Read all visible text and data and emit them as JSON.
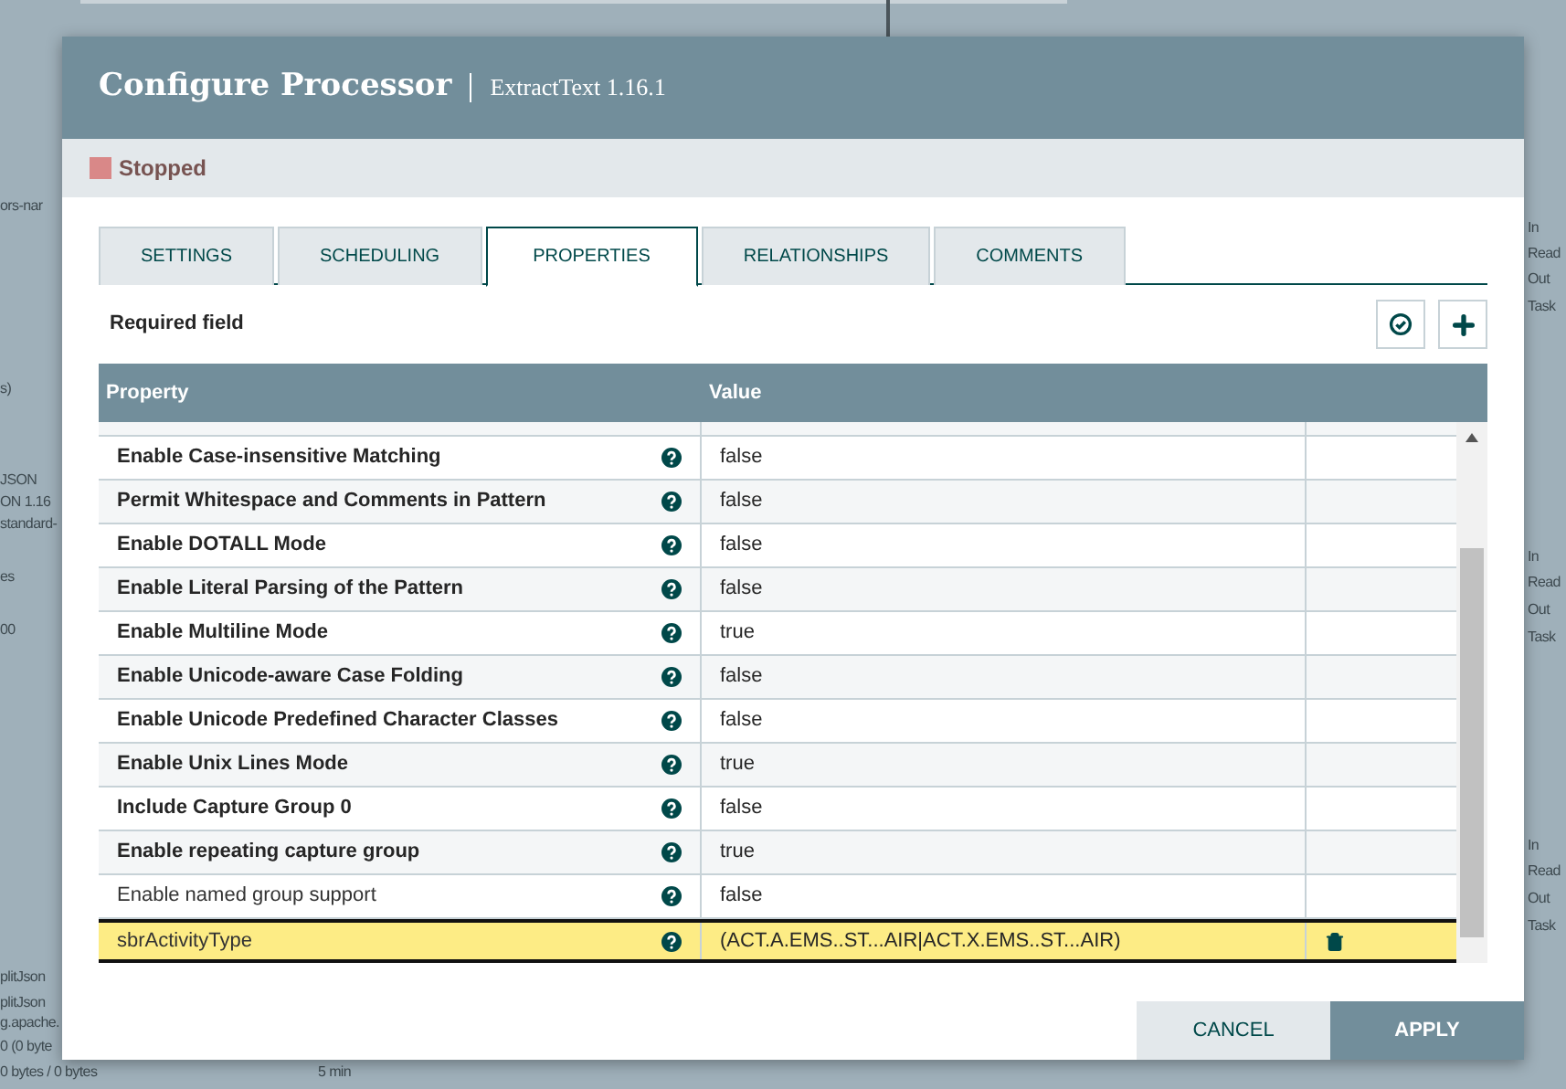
{
  "canvas": {
    "labels": [
      {
        "text": "ors-nar"
      },
      {
        "text": "s)"
      },
      {
        "text": "JSON"
      },
      {
        "text": "ON 1.16"
      },
      {
        "text": "standard-"
      },
      {
        "text": "es"
      },
      {
        "text": "00"
      },
      {
        "text": "plitJson"
      },
      {
        "text": "plitJson"
      },
      {
        "text": "g.apache."
      },
      {
        "text": "0 (0 byte"
      },
      {
        "text": "0 bytes / 0 bytes"
      },
      {
        "text": "5 min"
      },
      {
        "text": "In"
      },
      {
        "text": "Read"
      },
      {
        "text": "Out"
      },
      {
        "text": "Task"
      },
      {
        "text": "In"
      },
      {
        "text": "Read"
      },
      {
        "text": "Out"
      },
      {
        "text": "Task"
      },
      {
        "text": "In"
      },
      {
        "text": "Read"
      },
      {
        "text": "Out"
      },
      {
        "text": "Task"
      }
    ]
  },
  "dialog": {
    "title": "Configure Processor",
    "subtitle": "ExtractText 1.16.1",
    "status": {
      "label": "Stopped",
      "color": "#d98888"
    },
    "tabs": [
      {
        "label": "SETTINGS",
        "selected": false
      },
      {
        "label": "SCHEDULING",
        "selected": false
      },
      {
        "label": "PROPERTIES",
        "selected": true
      },
      {
        "label": "RELATIONSHIPS",
        "selected": false
      },
      {
        "label": "COMMENTS",
        "selected": false
      }
    ],
    "required_note": "Required field",
    "table": {
      "columns": [
        "Property",
        "Value"
      ],
      "rows": [
        {
          "property": "Enable Case-insensitive Matching",
          "value": "false",
          "required": true,
          "selected": false
        },
        {
          "property": "Permit Whitespace and Comments in Pattern",
          "value": "false",
          "required": true,
          "selected": false
        },
        {
          "property": "Enable DOTALL Mode",
          "value": "false",
          "required": true,
          "selected": false
        },
        {
          "property": "Enable Literal Parsing of the Pattern",
          "value": "false",
          "required": true,
          "selected": false
        },
        {
          "property": "Enable Multiline Mode",
          "value": "true",
          "required": true,
          "selected": false
        },
        {
          "property": "Enable Unicode-aware Case Folding",
          "value": "false",
          "required": true,
          "selected": false
        },
        {
          "property": "Enable Unicode Predefined Character Classes",
          "value": "false",
          "required": true,
          "selected": false
        },
        {
          "property": "Enable Unix Lines Mode",
          "value": "true",
          "required": true,
          "selected": false
        },
        {
          "property": "Include Capture Group 0",
          "value": "false",
          "required": true,
          "selected": false
        },
        {
          "property": "Enable repeating capture group",
          "value": "true",
          "required": true,
          "selected": false
        },
        {
          "property": "Enable named group support",
          "value": "false",
          "required": false,
          "selected": false
        },
        {
          "property": "sbrActivityType",
          "value": "(ACT.A.EMS..ST...AIR|ACT.X.EMS..ST...AIR)",
          "required": false,
          "selected": true,
          "deletable": true
        }
      ]
    },
    "buttons": {
      "cancel": "CANCEL",
      "apply": "APPLY"
    }
  }
}
